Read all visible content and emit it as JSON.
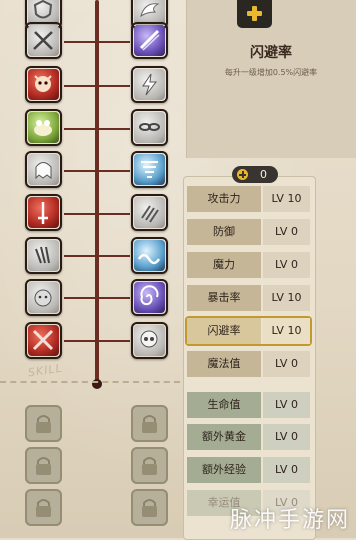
{
  "stat_detail": {
    "title": "闪避率",
    "description": "每升一级增加0.5%闪避率"
  },
  "points": {
    "value": "0"
  },
  "attributes": [
    {
      "name": "攻击力",
      "level": "LV 10",
      "style": "normal"
    },
    {
      "name": "防御",
      "level": "LV 0",
      "style": "normal"
    },
    {
      "name": "魔力",
      "level": "LV 0",
      "style": "normal"
    },
    {
      "name": "暴击率",
      "level": "LV 10",
      "style": "normal"
    },
    {
      "name": "闪避率",
      "level": "LV 10",
      "style": "selected"
    },
    {
      "name": "魔法值",
      "level": "LV 0",
      "style": "normal"
    },
    {
      "name": "生命值",
      "level": "LV 0",
      "style": "green"
    },
    {
      "name": "额外黄金",
      "level": "LV 0",
      "style": "green"
    },
    {
      "name": "额外经验",
      "level": "LV 0",
      "style": "green"
    },
    {
      "name": "幸运值",
      "level": "LV 0",
      "style": "faded"
    }
  ],
  "skill_tree": {
    "tag": "SKILL",
    "left_icons": [
      "shield-icon",
      "swords-icon",
      "demon-icon",
      "frog-icon",
      "ghost-icon",
      "sword-icon",
      "claw-icon",
      "beast-icon",
      "cross-swords-icon"
    ],
    "right_icons": [
      "wing-icon",
      "slash-icon",
      "bolt-icon",
      "chains-icon",
      "tornado-icon",
      "claw-mark-icon",
      "wave-icon",
      "vortex-icon",
      "skull-icon"
    ]
  },
  "watermark": "脉冲手游网",
  "colors": {
    "trunk": "#6b2d22",
    "selected_border": "#c2992f",
    "plus_icon": "#e8b82f"
  }
}
